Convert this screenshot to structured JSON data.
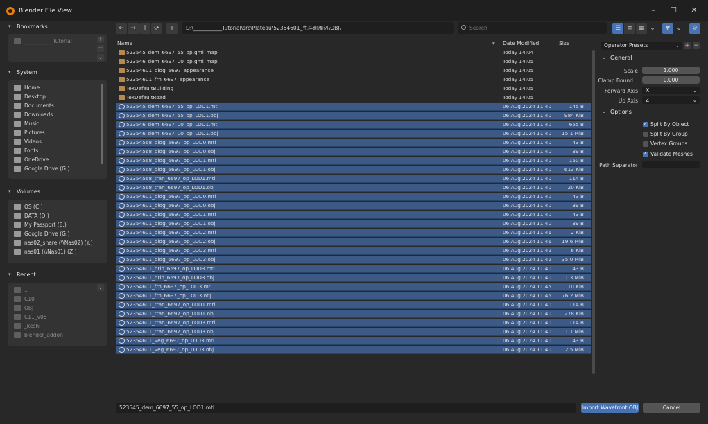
{
  "window": {
    "title": "Blender File View",
    "minimize": "–",
    "maximize": "☐",
    "close": "✕"
  },
  "sidebar": {
    "bookmarks": {
      "label": "Bookmarks",
      "items": [
        "___________Tutorial"
      ]
    },
    "system": {
      "label": "System",
      "items": [
        "Home",
        "Desktop",
        "Documents",
        "Downloads",
        "Music",
        "Pictures",
        "Videos",
        "Fonts",
        "OneDrive",
        "Google Drive (G:)"
      ]
    },
    "volumes": {
      "label": "Volumes",
      "items": [
        "OS (C:)",
        "DATA (D:)",
        "My Passport (E:)",
        "Google Drive (G:)",
        "nas02_share (\\\\Nas02) (Y:)",
        "nas01 (\\\\Nas01) (Z:)"
      ]
    },
    "recent": {
      "label": "Recent",
      "items": [
        "1",
        "C10",
        "OBJ",
        "C11_v05",
        "_keshi",
        "blender_addon"
      ]
    }
  },
  "toolbar": {
    "path": "D:\\___________Tutorial\\src\\Plateau\\52354601_先斗町周辺\\OBJ\\",
    "search_placeholder": "Search"
  },
  "columns": {
    "name": "Name",
    "date": "Date Modified",
    "size": "Size"
  },
  "files": [
    {
      "name": "523545_dem_6697_55_op.gml_map",
      "date": "Today 14:04",
      "size": "",
      "type": "folder",
      "selected": false
    },
    {
      "name": "523546_dem_6697_00_op.gml_map",
      "date": "Today 14:05",
      "size": "",
      "type": "folder",
      "selected": false
    },
    {
      "name": "52354601_bldg_6697_appearance",
      "date": "Today 14:05",
      "size": "",
      "type": "folder",
      "selected": false
    },
    {
      "name": "52354601_frn_6697_appearance",
      "date": "Today 14:05",
      "size": "",
      "type": "folder",
      "selected": false
    },
    {
      "name": "TexDefaultBuilding",
      "date": "Today 14:05",
      "size": "",
      "type": "folder",
      "selected": false
    },
    {
      "name": "TexDefaultRoad",
      "date": "Today 14:05",
      "size": "",
      "type": "folder",
      "selected": false
    },
    {
      "name": "523545_dem_6697_55_op_LOD1.mtl",
      "date": "06 Aug 2024 11:40",
      "size": "145 B",
      "type": "file",
      "selected": true
    },
    {
      "name": "523545_dem_6697_55_op_LOD1.obj",
      "date": "06 Aug 2024 11:40",
      "size": "984 KiB",
      "type": "file",
      "selected": true
    },
    {
      "name": "523546_dem_6697_00_op_LOD1.mtl",
      "date": "06 Aug 2024 11:40",
      "size": "655 B",
      "type": "file",
      "selected": true
    },
    {
      "name": "523546_dem_6697_00_op_LOD1.obj",
      "date": "06 Aug 2024 11:40",
      "size": "15.1 MiB",
      "type": "file",
      "selected": true
    },
    {
      "name": "52354568_bldg_6697_op_LOD0.mtl",
      "date": "06 Aug 2024 11:40",
      "size": "43 B",
      "type": "file",
      "selected": true
    },
    {
      "name": "52354568_bldg_6697_op_LOD0.obj",
      "date": "06 Aug 2024 11:40",
      "size": "39 B",
      "type": "file",
      "selected": true
    },
    {
      "name": "52354568_bldg_6697_op_LOD1.mtl",
      "date": "06 Aug 2024 11:40",
      "size": "150 B",
      "type": "file",
      "selected": true
    },
    {
      "name": "52354568_bldg_6697_op_LOD1.obj",
      "date": "06 Aug 2024 11:40",
      "size": "613 KiB",
      "type": "file",
      "selected": true
    },
    {
      "name": "52354568_tran_6697_op_LOD1.mtl",
      "date": "06 Aug 2024 11:40",
      "size": "114 B",
      "type": "file",
      "selected": true
    },
    {
      "name": "52354568_tran_6697_op_LOD1.obj",
      "date": "06 Aug 2024 11:40",
      "size": "20 KiB",
      "type": "file",
      "selected": true
    },
    {
      "name": "52354601_bldg_6697_op_LOD0.mtl",
      "date": "06 Aug 2024 11:40",
      "size": "43 B",
      "type": "file",
      "selected": true
    },
    {
      "name": "52354601_bldg_6697_op_LOD0.obj",
      "date": "06 Aug 2024 11:40",
      "size": "39 B",
      "type": "file",
      "selected": true
    },
    {
      "name": "52354601_bldg_6697_op_LOD1.mtl",
      "date": "06 Aug 2024 11:40",
      "size": "43 B",
      "type": "file",
      "selected": true
    },
    {
      "name": "52354601_bldg_6697_op_LOD1.obj",
      "date": "06 Aug 2024 11:40",
      "size": "39 B",
      "type": "file",
      "selected": true
    },
    {
      "name": "52354601_bldg_6697_op_LOD2.mtl",
      "date": "06 Aug 2024 11:41",
      "size": "2 KiB",
      "type": "file",
      "selected": true
    },
    {
      "name": "52354601_bldg_6697_op_LOD2.obj",
      "date": "06 Aug 2024 11:41",
      "size": "19.6 MiB",
      "type": "file",
      "selected": true
    },
    {
      "name": "52354601_bldg_6697_op_LOD3.mtl",
      "date": "06 Aug 2024 11:42",
      "size": "6 KiB",
      "type": "file",
      "selected": true
    },
    {
      "name": "52354601_bldg_6697_op_LOD3.obj",
      "date": "06 Aug 2024 11:42",
      "size": "35.0 MiB",
      "type": "file",
      "selected": true
    },
    {
      "name": "52354601_brid_6697_op_LOD3.mtl",
      "date": "06 Aug 2024 11:40",
      "size": "43 B",
      "type": "file",
      "selected": true
    },
    {
      "name": "52354601_brid_6697_op_LOD3.obj",
      "date": "06 Aug 2024 11:40",
      "size": "1.3 MiB",
      "type": "file",
      "selected": true
    },
    {
      "name": "52354601_frn_6697_op_LOD3.mtl",
      "date": "06 Aug 2024 11:45",
      "size": "10 KiB",
      "type": "file",
      "selected": true
    },
    {
      "name": "52354601_frn_6697_op_LOD3.obj",
      "date": "06 Aug 2024 11:45",
      "size": "76.2 MiB",
      "type": "file",
      "selected": true
    },
    {
      "name": "52354601_tran_6697_op_LOD1.mtl",
      "date": "06 Aug 2024 11:40",
      "size": "114 B",
      "type": "file",
      "selected": true
    },
    {
      "name": "52354601_tran_6697_op_LOD1.obj",
      "date": "06 Aug 2024 11:40",
      "size": "278 KiB",
      "type": "file",
      "selected": true
    },
    {
      "name": "52354601_tran_6697_op_LOD3.mtl",
      "date": "06 Aug 2024 11:40",
      "size": "114 B",
      "type": "file",
      "selected": true
    },
    {
      "name": "52354601_tran_6697_op_LOD3.obj",
      "date": "06 Aug 2024 11:40",
      "size": "1.1 MiB",
      "type": "file",
      "selected": true
    },
    {
      "name": "52354601_veg_6697_op_LOD3.mtl",
      "date": "06 Aug 2024 11:40",
      "size": "43 B",
      "type": "file",
      "selected": true
    },
    {
      "name": "52354601_veg_6697_op_LOD3.obj",
      "date": "06 Aug 2024 11:40",
      "size": "2.5 MiB",
      "type": "file",
      "selected": true
    }
  ],
  "operator": {
    "presets_label": "Operator Presets",
    "general_label": "General",
    "scale_label": "Scale",
    "scale_value": "1.000",
    "clamp_label": "Clamp Bound...",
    "clamp_value": "0.000",
    "forward_label": "Forward Axis",
    "forward_value": "X",
    "up_label": "Up Axis",
    "up_value": "Z",
    "options_label": "Options",
    "split_object": "Split By Object",
    "split_object_on": true,
    "split_group": "Split By Group",
    "split_group_on": false,
    "vertex_groups": "Vertex Groups",
    "vertex_groups_on": false,
    "validate_meshes": "Validate Meshes",
    "validate_meshes_on": true,
    "path_sep_label": "Path Separator",
    "path_sep_value": ""
  },
  "bottom": {
    "filename": "523545_dem_6697_55_op_LOD1.mtl",
    "import_label": "Import Wavefront OBJ",
    "cancel_label": "Cancel"
  },
  "colors": {
    "accent": "#4772b3",
    "selection": "#3d5a87",
    "folder": "#b58a4c"
  }
}
